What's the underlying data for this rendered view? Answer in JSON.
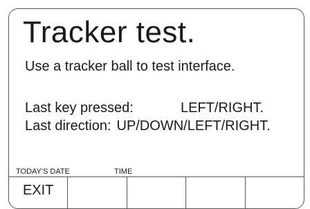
{
  "screen": {
    "title": "Tracker test.",
    "subtitle": "Use a tracker ball to test interface.",
    "last_key": {
      "label": "Last key pressed:",
      "value": "LEFT/RIGHT."
    },
    "last_direction": {
      "label": "Last direction:",
      "value": "UP/DOWN/LEFT/RIGHT."
    }
  },
  "footer": {
    "date_label": "TODAY'S DATE",
    "time_label": "TIME"
  },
  "softkeys": [
    "EXIT",
    "",
    "",
    "",
    ""
  ]
}
